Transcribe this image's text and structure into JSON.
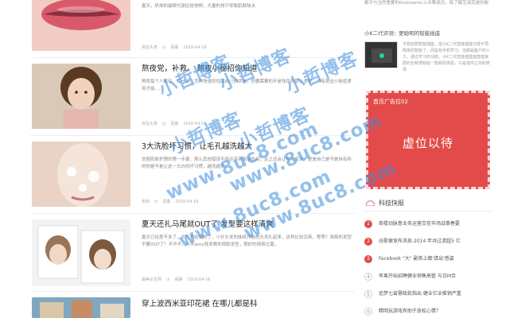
{
  "articles": [
    {
      "title": "",
      "excerpt": "夏天，机体的最根代谢比较快啊，大量的排汗导致肌肤缺水",
      "category": "淘宝头条",
      "author": "喜葵",
      "date": "2016-04-16"
    },
    {
      "title": "熬夜党，补救。 熬夜小秘招你知道",
      "excerpt": "熬夜每个人都有，并一定，怎样快速的找回自己的状态，你要需要的不是钱花的那么多好，只有把这小秘招拿到才能……",
      "category": "淘宝头条",
      "author": "喜葵",
      "date": "2016-04-16"
    },
    {
      "title": "3大洗脸坏习惯，让毛孔越洗越大",
      "excerpt": "洗脸肌肤护理的第一步骤，那么其他错误不但达不到清洁作用，反之还会让毛孔变大，是是自己是不是自有所的你是不是让这一大白的坏习惯，越洗越大！",
      "category": "未知",
      "author": "喜葵",
      "date": "2016-04-16"
    },
    {
      "title": "夏天还扎马尾就OUT了 发型要这样清爽",
      "excerpt": "夏天已经差不多了，天气开始转热了，小长头发的妹纸开始把头发扎起来，这样比较凉爽，等等？清爽的发型不要OUT了！不不不，今天amy就来教你两款发型，很好的清爽过夏。",
      "category": "最美女生网",
      "author": "毒磐",
      "date": "2016-04-16"
    },
    {
      "title": "穿上波西米亚印花裙 在哪儿都是科",
      "excerpt": "",
      "category": "",
      "author": "",
      "date": ""
    }
  ],
  "sidebar": {
    "top_text": "都不与当然重要的Kickstarter上众筹成功，除了解压液其是的秘",
    "post_title": "小K二代评测：更聪明的智能插座",
    "post_text": "不想还刚智能插座，但小K二代智能插座已经不再简单的智能了，而是有手机学习、当做是客户的人工。通过学习的功能，小K二代智能插座能智能家居的全新感知给一款新的体验，只是插件之内的表现",
    "ad_label": "首页广告位02",
    "ad_text": "虚位以待",
    "news_heading": "科技快报",
    "news": [
      {
        "n": "1",
        "text": "商楼动脉鲁业务运营交信市场战事春要"
      },
      {
        "n": "2",
        "text": "谷歌便发布消息:2014 年共过滤超5 亿"
      },
      {
        "n": "3",
        "text": "Facebook \"大\" 副首上都'请出'感姿"
      },
      {
        "n": "4",
        "text": "苹果开始招聘健业销售高管 与日M合"
      },
      {
        "n": "5",
        "text": "追梦七省需政款指出 健业亿业推销严重"
      },
      {
        "n": "6",
        "text": "精明玩游戏有助于放松心情？"
      }
    ]
  },
  "watermarks": [
    "小哲博客",
    "小哲博客",
    "小哲博客",
    "小哲博客",
    "小哲博客",
    "www.8uc8.com",
    "www.8uc8.com",
    "www.8uc8.com",
    "www.8uc8.com"
  ],
  "colors": {
    "accent": "#e34b4b",
    "watermark": "#3c8cdc"
  }
}
